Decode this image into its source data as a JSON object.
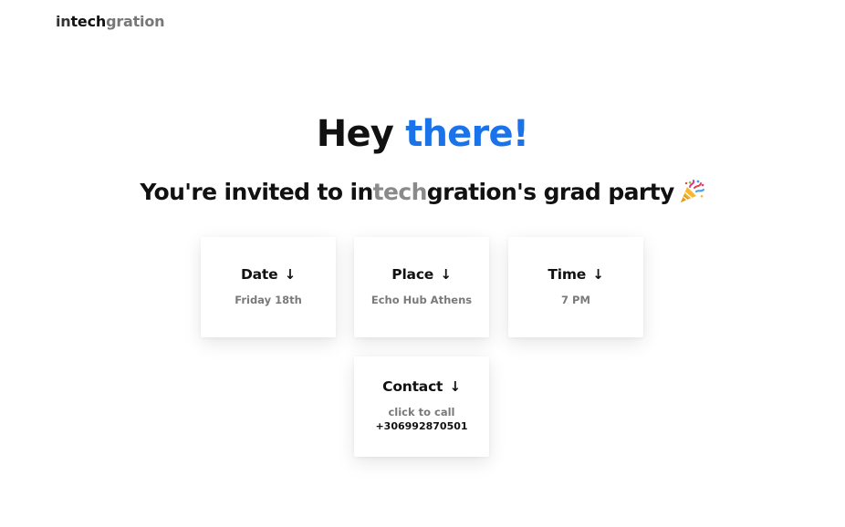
{
  "logo": {
    "part1": "in",
    "part2": "tech",
    "part3": "gration"
  },
  "hero": {
    "prefix": "Hey ",
    "accent": "there!"
  },
  "subtitle": {
    "before": "You're invited to in",
    "brand_mid": "tech",
    "after": "gration's grad party"
  },
  "cards": {
    "date": {
      "title": "Date",
      "value": "Friday 18th"
    },
    "place": {
      "title": "Place",
      "value": "Echo Hub Athens"
    },
    "time": {
      "title": "Time",
      "value": "7 PM"
    },
    "contact": {
      "title": "Contact",
      "hint": "click to call",
      "phone": "+306992870501"
    }
  },
  "icons": {
    "arrow": "↓",
    "celebration": "party-popper-icon"
  },
  "colors": {
    "accent": "#1a73e8",
    "muted": "#7a7a7a",
    "text": "#111111"
  }
}
